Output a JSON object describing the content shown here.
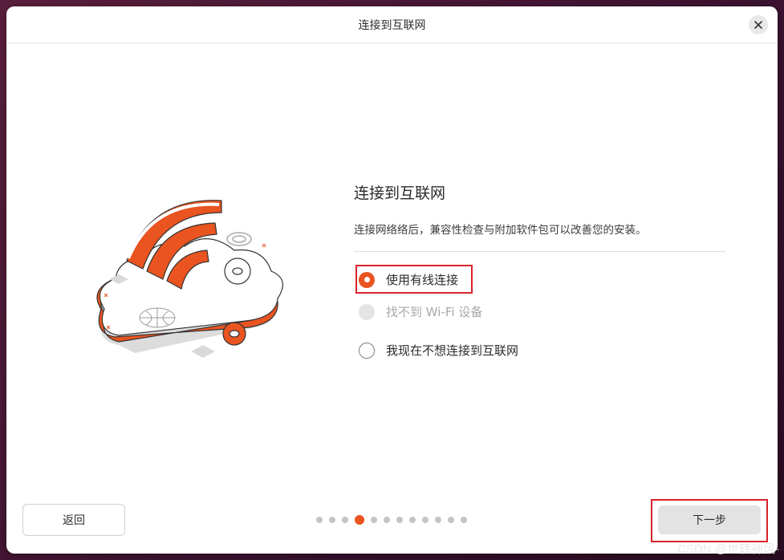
{
  "window": {
    "title": "连接到互联网"
  },
  "main": {
    "heading": "连接到互联网",
    "description": "连接网络络后，兼容性检查与附加软件包可以改善您的安装。",
    "options": [
      {
        "label": "使用有线连接",
        "state": "checked"
      },
      {
        "label": "找不到 Wi-Fi 设备",
        "state": "disabled"
      },
      {
        "label": "我现在不想连接到互联网",
        "state": "unchecked"
      }
    ]
  },
  "footer": {
    "back_label": "返回",
    "next_label": "下一步",
    "page_count": 12,
    "current_page": 4
  },
  "watermark": "CSDN @世转神风-",
  "colors": {
    "accent": "#e95420",
    "annotation": "#d8232a"
  }
}
